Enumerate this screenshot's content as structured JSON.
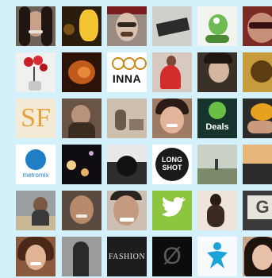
{
  "grid": {
    "background": "#d4f0fb",
    "rows": [
      [
        {
          "name": "avatar-woman-dark-hair",
          "label": "",
          "bg": "#6d6158"
        },
        {
          "name": "avatar-yellow-lights",
          "label": "",
          "bg": "#2a1d0c"
        },
        {
          "name": "avatar-man-glasses",
          "label": "",
          "bg": "#9a8a82"
        },
        {
          "name": "avatar-black-sign",
          "label": "",
          "bg": "#cfd0c9"
        },
        {
          "name": "avatar-green-dragon",
          "label": "",
          "bg": "#f3f4ef"
        },
        {
          "name": "avatar-woman-red-sunglasses",
          "label": "",
          "bg": "#7c2b24"
        }
      ],
      [
        {
          "name": "avatar-red-flowers",
          "label": "",
          "bg": "#f0f0ef"
        },
        {
          "name": "avatar-orange-dark",
          "label": "",
          "bg": "#2b1407"
        },
        {
          "name": "avatar-inna-logo",
          "label": "INNA",
          "bg": "#ffffff"
        },
        {
          "name": "avatar-woman-red-dress",
          "label": "",
          "bg": "#d8c9c0"
        },
        {
          "name": "avatar-woman-dark-portrait",
          "label": "",
          "bg": "#3a3126"
        },
        {
          "name": "avatar-yellow-partial",
          "label": "",
          "bg": "#c79b3c"
        }
      ],
      [
        {
          "name": "avatar-sf-letters",
          "label": "SF",
          "bg": "#f4ebd6"
        },
        {
          "name": "avatar-brown-photo",
          "label": "",
          "bg": "#6a5446"
        },
        {
          "name": "avatar-sepia-scene",
          "label": "",
          "bg": "#cdbfae"
        },
        {
          "name": "avatar-smiling-woman",
          "label": "",
          "bg": "#9f7b66"
        },
        {
          "name": "avatar-deals-logo",
          "label": "Deals",
          "bg": "#17352d"
        },
        {
          "name": "avatar-hand-badge",
          "label": "",
          "bg": "#2a2a2a"
        }
      ],
      [
        {
          "name": "avatar-metromix-logo",
          "label": "metromix",
          "bg": "#ffffff"
        },
        {
          "name": "avatar-bokeh-dark",
          "label": "",
          "bg": "#0f0d12"
        },
        {
          "name": "avatar-bw-figure",
          "label": "",
          "bg": "#2d2d2d"
        },
        {
          "name": "avatar-long-shot-logo",
          "label": "LONG SHOT",
          "bg": "#ffffff"
        },
        {
          "name": "avatar-landscape",
          "label": "",
          "bg": "#c9d0c4"
        },
        {
          "name": "avatar-partial-photo",
          "label": "",
          "bg": "#e8b57a"
        }
      ],
      [
        {
          "name": "avatar-beach-man",
          "label": "",
          "bg": "#9aa0a2"
        },
        {
          "name": "avatar-smiling-man",
          "label": "",
          "bg": "#5a4b40"
        },
        {
          "name": "avatar-man-closeup",
          "label": "",
          "bg": "#cdbfb2"
        },
        {
          "name": "avatar-twitter-bird",
          "label": "",
          "bg": "#8cc63f"
        },
        {
          "name": "avatar-woman-crouching",
          "label": "",
          "bg": "#ede5dc"
        },
        {
          "name": "avatar-sign-partial",
          "label": "G",
          "bg": "#3a3a3a"
        }
      ],
      [
        {
          "name": "avatar-smiling-woman-2",
          "label": "",
          "bg": "#8a5a3e"
        },
        {
          "name": "avatar-gray-figure",
          "label": "",
          "bg": "#9b9b9b"
        },
        {
          "name": "avatar-fashion-text",
          "label": "FASHION",
          "bg": "#1d1d1d"
        },
        {
          "name": "avatar-empty-set-logo",
          "label": "Ø",
          "bg": "#0c0c0c"
        },
        {
          "name": "avatar-blue-star-person",
          "label": "",
          "bg": "#f7fbfd"
        },
        {
          "name": "avatar-asian-woman",
          "label": "",
          "bg": "#c9a58d"
        }
      ]
    ]
  }
}
